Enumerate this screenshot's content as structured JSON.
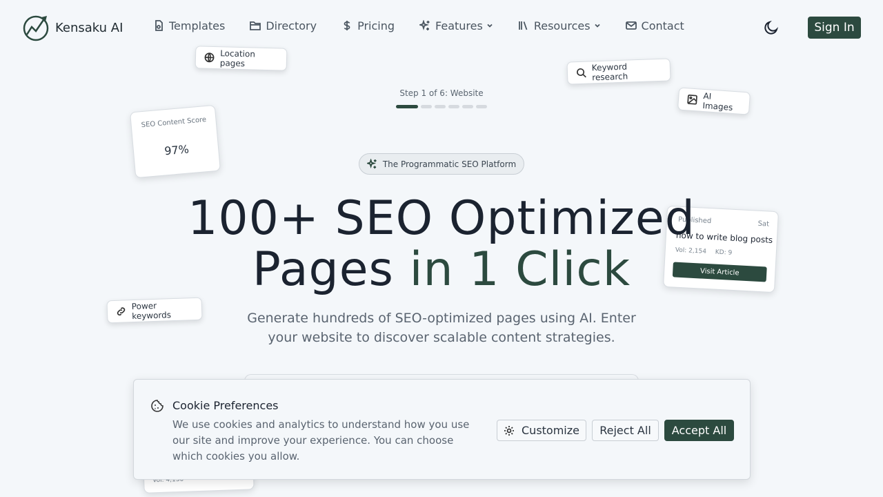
{
  "brand": {
    "name": "Kensaku AI",
    "accent": "#2c4a3f"
  },
  "nav": {
    "items": [
      {
        "label": "Templates",
        "icon": "file-icon"
      },
      {
        "label": "Directory",
        "icon": "folder-icon"
      },
      {
        "label": "Pricing",
        "icon": "dollar-icon"
      },
      {
        "label": "Features",
        "icon": "sparkle-icon",
        "dropdown": true
      },
      {
        "label": "Resources",
        "icon": "library-icon",
        "dropdown": true
      },
      {
        "label": "Contact",
        "icon": "mail-icon"
      }
    ],
    "sign_in": "Sign In"
  },
  "floating": {
    "location_pages": "Location pages",
    "keyword_research": "Keyword research",
    "ai_images": "AI Images",
    "power_keywords": "Power keywords",
    "score_card": {
      "label": "SEO Content Score",
      "value": "97%"
    },
    "article_card": {
      "status": "Published",
      "day": "Sat",
      "title": "how to write blog posts",
      "vol": "Vol: 2,154",
      "kd": "KD: 9",
      "button": "Visit Article"
    },
    "bottom_card_vol": "Vol: 4,130"
  },
  "steps": {
    "label": "Step 1 of 6: Website",
    "total": 6,
    "current": 1
  },
  "badge": "The Programmatic SEO Platform",
  "hero": {
    "line1": "100+ SEO Optimized",
    "line2_a": "Pages ",
    "line2_b": "in 1 Click"
  },
  "subtitle": "Generate hundreds of SEO-optimized pages using AI. Enter your website to discover scalable content strategies.",
  "cookie": {
    "title": "Cookie Preferences",
    "body": "We use cookies and analytics to understand how you use our site and improve your experience. You can choose which cookies you allow.",
    "customize": "Customize",
    "reject": "Reject All",
    "accept": "Accept All"
  }
}
